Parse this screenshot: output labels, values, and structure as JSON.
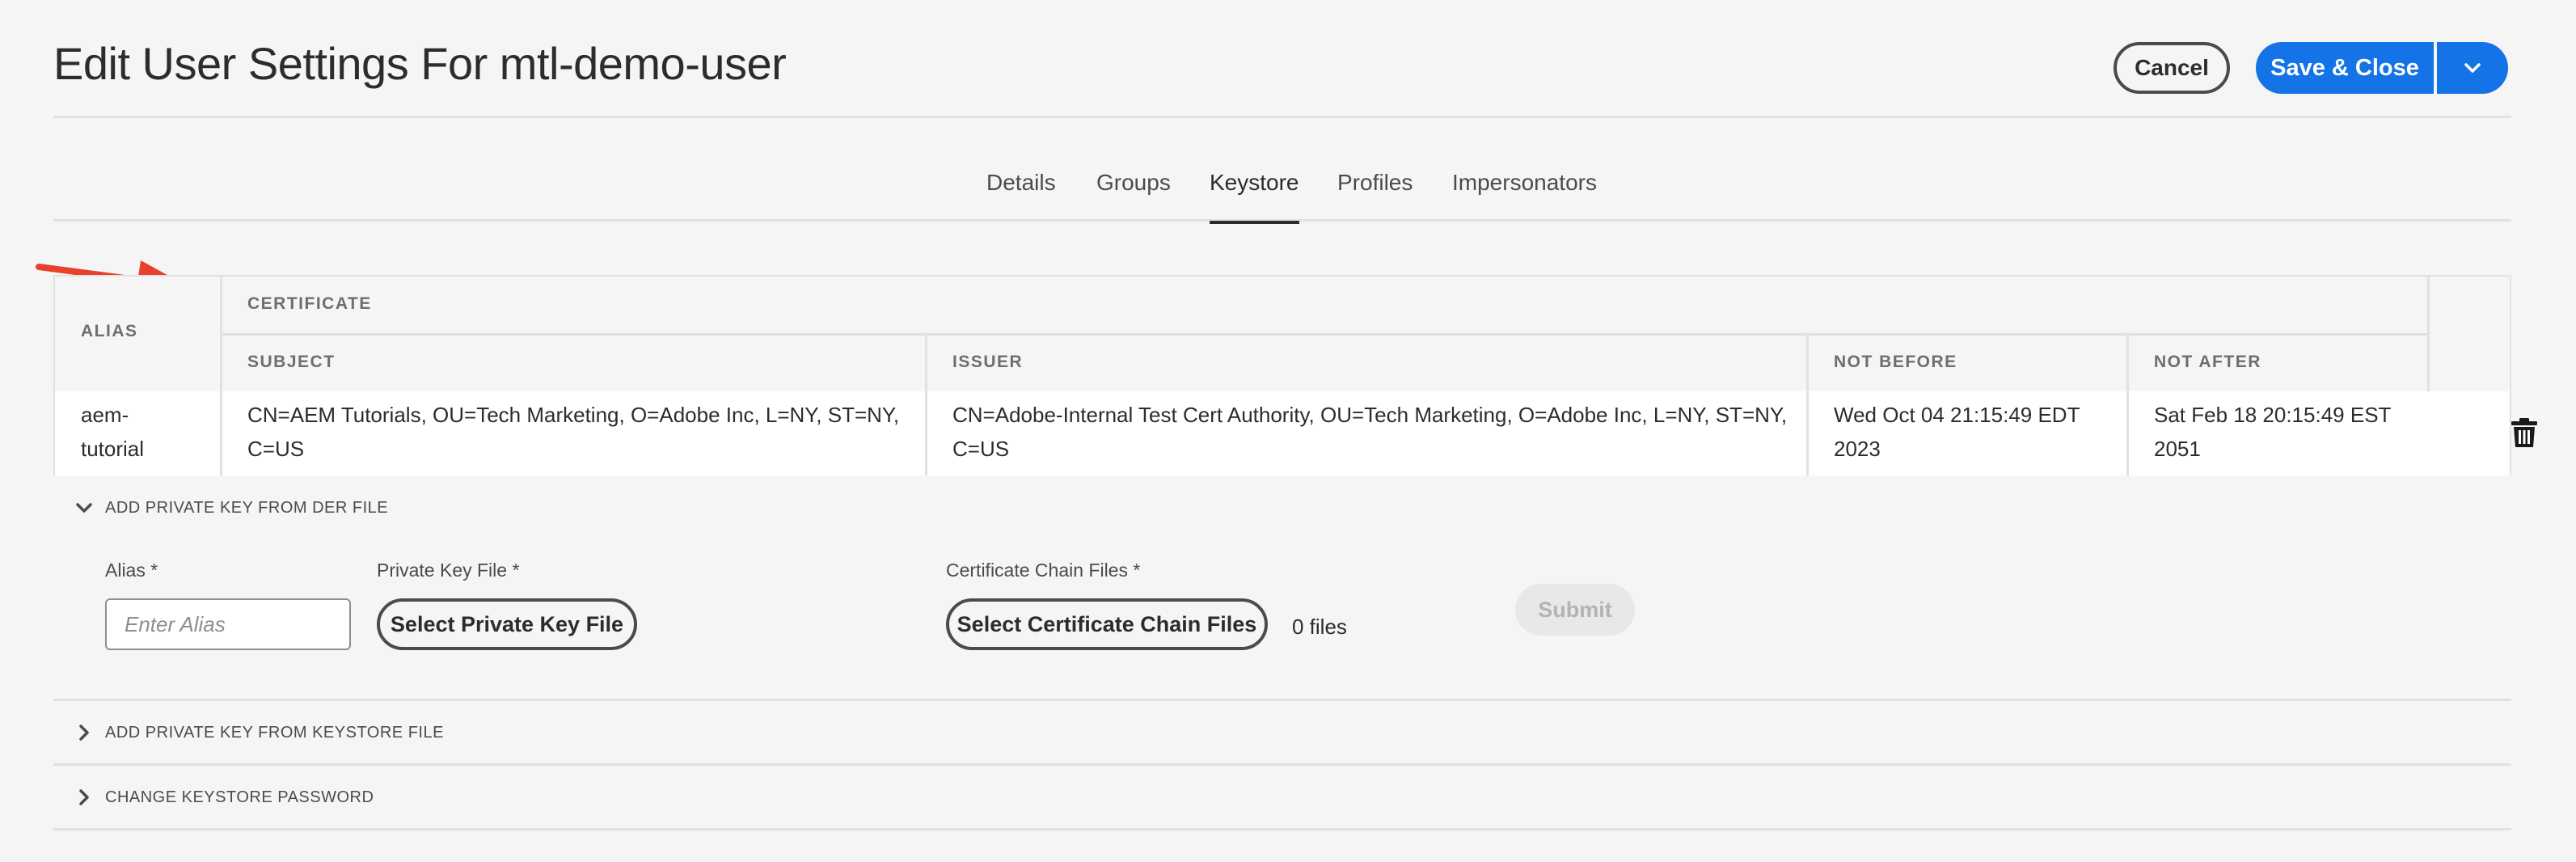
{
  "header": {
    "title": "Edit User Settings For mtl-demo-user",
    "cancel_label": "Cancel",
    "save_label": "Save & Close"
  },
  "tabs": [
    {
      "label": "Details",
      "active": false
    },
    {
      "label": "Groups",
      "active": false
    },
    {
      "label": "Keystore",
      "active": true
    },
    {
      "label": "Profiles",
      "active": false
    },
    {
      "label": "Impersonators",
      "active": false
    }
  ],
  "keystore_table": {
    "headers": {
      "alias": "ALIAS",
      "certificate": "CERTIFICATE",
      "subject": "SUBJECT",
      "issuer": "ISSUER",
      "not_before": "NOT BEFORE",
      "not_after": "NOT AFTER"
    },
    "rows": [
      {
        "alias_line1": "aem-",
        "alias_line2": "tutorial",
        "subject_line1": "CN=AEM Tutorials, OU=Tech Marketing, O=Adobe Inc, L=NY, ST=NY,",
        "subject_line2": "C=US",
        "issuer_line1": "CN=Adobe-Internal Test Cert Authority, OU=Tech Marketing, O=Adobe Inc, L=NY, ST=NY,",
        "issuer_line2": "C=US",
        "not_before_line1": "Wed Oct 04 21:15:49 EDT",
        "not_before_line2": "2023",
        "not_after_line1": "Sat Feb 18 20:15:49 EST",
        "not_after_line2": "2051"
      }
    ]
  },
  "der_section": {
    "title": "ADD PRIVATE KEY FROM DER FILE",
    "expanded": true,
    "alias_label": "Alias *",
    "alias_placeholder": "Enter Alias",
    "alias_value": "",
    "private_key_label": "Private Key File *",
    "private_key_button": "Select Private Key File",
    "cert_chain_label": "Certificate Chain Files *",
    "cert_chain_button": "Select Certificate Chain Files",
    "file_count": "0 files",
    "submit_label": "Submit"
  },
  "keystore_section": {
    "title": "ADD PRIVATE KEY FROM KEYSTORE FILE",
    "expanded": false
  },
  "password_section": {
    "title": "CHANGE KEYSTORE PASSWORD",
    "expanded": false
  },
  "colors": {
    "accent": "#1473e6",
    "arrow": "#e8402b",
    "background": "#f5f5f5"
  },
  "icons": [
    "chevron-down-icon",
    "trash-icon",
    "chevron-right-icon",
    "annotation-arrow"
  ]
}
